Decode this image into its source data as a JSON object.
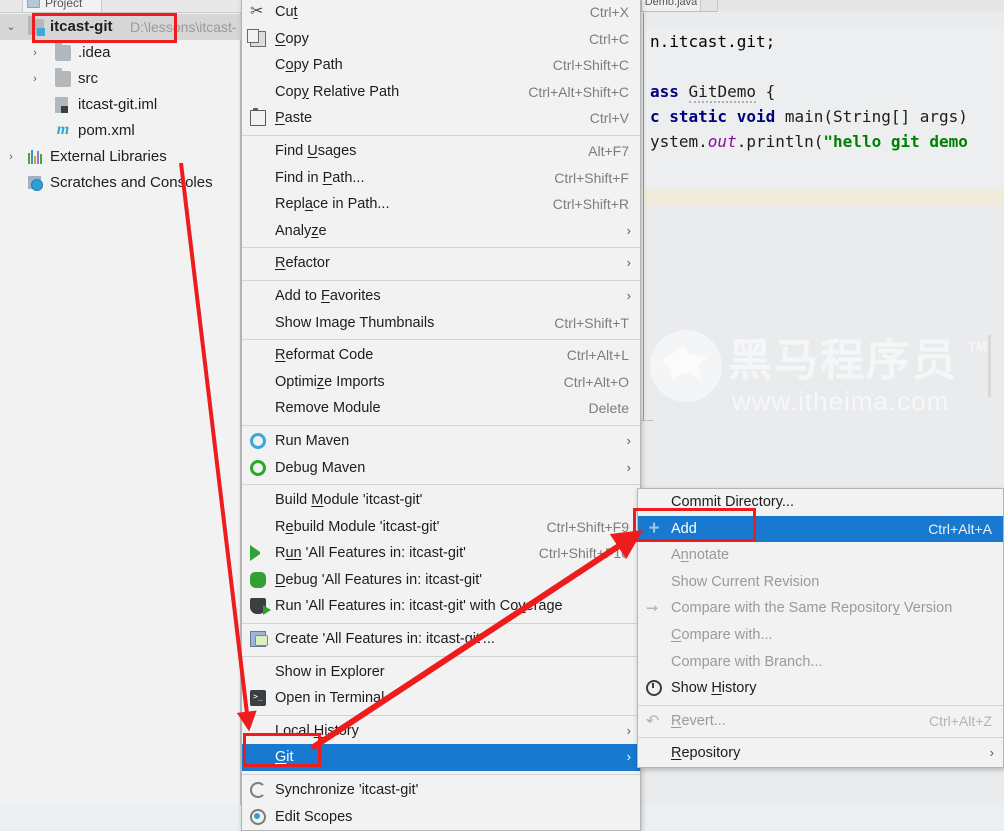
{
  "app": {
    "project_tool_tab": "Project",
    "editor_tab": "Demo.java"
  },
  "project_tree": [
    {
      "label": "itcast-git",
      "path": "D:\\lessons\\itcast-",
      "icon": "module-folder-icon",
      "arrow": "⌄",
      "indent": 0,
      "selected": true,
      "bold": true
    },
    {
      "label": ".idea",
      "path": "",
      "icon": "folder-icon",
      "arrow": "›",
      "indent": 1,
      "selected": false,
      "bold": false
    },
    {
      "label": "src",
      "path": "",
      "icon": "folder-icon",
      "arrow": "›",
      "indent": 1,
      "selected": false,
      "bold": false
    },
    {
      "label": "itcast-git.iml",
      "path": "",
      "icon": "iml-file-icon",
      "arrow": "",
      "indent": 2,
      "selected": false,
      "bold": false
    },
    {
      "label": "pom.xml",
      "path": "",
      "icon": "maven-m-icon",
      "arrow": "",
      "indent": 2,
      "selected": false,
      "bold": false
    },
    {
      "label": "External Libraries",
      "path": "",
      "icon": "libraries-icon",
      "arrow": "›",
      "indent": 0,
      "selected": false,
      "bold": false
    },
    {
      "label": "Scratches and Consoles",
      "path": "",
      "icon": "scratches-icon",
      "arrow": "",
      "indent": 0,
      "selected": false,
      "bold": false
    }
  ],
  "editor": {
    "lines": [
      "n.itcast.git;",
      "",
      "ass GitDemo {",
      "c static void main(String[] args)",
      "ystem.out.println(\"hello git demo"
    ],
    "visible_code_fragment_note": "partially scrolled, left side clipped by menus"
  },
  "watermark": {
    "cn_text": "黑马程序员",
    "tm": "TM",
    "url": "www.itheima.com"
  },
  "context_menu": {
    "name": "project-context-menu",
    "items": [
      {
        "label": "Cut",
        "shortcut": "Ctrl+X",
        "icon": "cut-icon",
        "arrow": false,
        "state": "normal",
        "mnemonic": "t"
      },
      {
        "label": "Copy",
        "shortcut": "Ctrl+C",
        "icon": "copy-icon",
        "arrow": false,
        "state": "normal",
        "mnemonic": "C"
      },
      {
        "label": "Copy Path",
        "shortcut": "Ctrl+Shift+C",
        "icon": "",
        "arrow": false,
        "state": "normal",
        "mnemonic": "o"
      },
      {
        "label": "Copy Relative Path",
        "shortcut": "Ctrl+Alt+Shift+C",
        "icon": "",
        "arrow": false,
        "state": "normal",
        "mnemonic": "y"
      },
      {
        "label": "Paste",
        "shortcut": "Ctrl+V",
        "icon": "paste-icon",
        "arrow": false,
        "state": "normal",
        "mnemonic": "P"
      },
      {
        "separator": true
      },
      {
        "label": "Find Usages",
        "shortcut": "Alt+F7",
        "icon": "",
        "arrow": false,
        "state": "normal",
        "mnemonic": "U"
      },
      {
        "label": "Find in Path...",
        "shortcut": "Ctrl+Shift+F",
        "icon": "",
        "arrow": false,
        "state": "normal",
        "mnemonic": "P"
      },
      {
        "label": "Replace in Path...",
        "shortcut": "Ctrl+Shift+R",
        "icon": "",
        "arrow": false,
        "state": "normal",
        "mnemonic": "a"
      },
      {
        "label": "Analyze",
        "shortcut": "",
        "icon": "",
        "arrow": true,
        "state": "normal",
        "mnemonic": "z"
      },
      {
        "separator": true
      },
      {
        "label": "Refactor",
        "shortcut": "",
        "icon": "",
        "arrow": true,
        "state": "normal",
        "mnemonic": "R"
      },
      {
        "separator": true
      },
      {
        "label": "Add to Favorites",
        "shortcut": "",
        "icon": "",
        "arrow": true,
        "state": "normal",
        "mnemonic": "F"
      },
      {
        "label": "Show Image Thumbnails",
        "shortcut": "Ctrl+Shift+T",
        "icon": "",
        "arrow": false,
        "state": "normal",
        "mnemonic": ""
      },
      {
        "separator": true
      },
      {
        "label": "Reformat Code",
        "shortcut": "Ctrl+Alt+L",
        "icon": "",
        "arrow": false,
        "state": "normal",
        "mnemonic": "R"
      },
      {
        "label": "Optimize Imports",
        "shortcut": "Ctrl+Alt+O",
        "icon": "",
        "arrow": false,
        "state": "normal",
        "mnemonic": "z"
      },
      {
        "label": "Remove Module",
        "shortcut": "Delete",
        "icon": "",
        "arrow": false,
        "state": "normal",
        "mnemonic": ""
      },
      {
        "separator": true
      },
      {
        "label": "Run Maven",
        "shortcut": "",
        "icon": "gear-blue-icon",
        "arrow": true,
        "state": "normal",
        "mnemonic": ""
      },
      {
        "label": "Debug Maven",
        "shortcut": "",
        "icon": "gear-green-icon",
        "arrow": true,
        "state": "normal",
        "mnemonic": ""
      },
      {
        "separator": true
      },
      {
        "label": "Build Module 'itcast-git'",
        "shortcut": "",
        "icon": "",
        "arrow": false,
        "state": "normal",
        "mnemonic": "M"
      },
      {
        "label": "Rebuild Module 'itcast-git'",
        "shortcut": "Ctrl+Shift+F9",
        "icon": "",
        "arrow": false,
        "state": "normal",
        "mnemonic": "e"
      },
      {
        "label": "Run 'All Features in: itcast-git'",
        "shortcut": "Ctrl+Shift+F10",
        "icon": "run-icon",
        "arrow": false,
        "state": "normal",
        "mnemonic": "un"
      },
      {
        "label": "Debug 'All Features in: itcast-git'",
        "shortcut": "",
        "icon": "debug-icon",
        "arrow": false,
        "state": "normal",
        "mnemonic": "D"
      },
      {
        "label": "Run 'All Features in: itcast-git' with Coverage",
        "shortcut": "",
        "icon": "coverage-icon",
        "arrow": false,
        "state": "normal",
        "mnemonic": "v"
      },
      {
        "separator": true
      },
      {
        "label": "Create 'All Features in: itcast-git'...",
        "shortcut": "",
        "icon": "create-config-icon",
        "arrow": false,
        "state": "normal",
        "mnemonic": ""
      },
      {
        "separator": true
      },
      {
        "label": "Show in Explorer",
        "shortcut": "",
        "icon": "",
        "arrow": false,
        "state": "normal",
        "mnemonic": ""
      },
      {
        "label": "Open in Terminal",
        "shortcut": "",
        "icon": "terminal-icon",
        "arrow": false,
        "state": "normal",
        "mnemonic": ""
      },
      {
        "separator": true
      },
      {
        "label": "Local History",
        "shortcut": "",
        "icon": "",
        "arrow": true,
        "state": "normal",
        "mnemonic": "H"
      },
      {
        "label": "Git",
        "shortcut": "",
        "icon": "",
        "arrow": true,
        "state": "selected",
        "mnemonic": "G"
      },
      {
        "separator": true
      },
      {
        "label": "Synchronize 'itcast-git'",
        "shortcut": "",
        "icon": "sync-icon",
        "arrow": false,
        "state": "normal",
        "mnemonic": ""
      },
      {
        "label": "Edit Scopes",
        "shortcut": "",
        "icon": "scopes-icon",
        "arrow": false,
        "state": "normal",
        "mnemonic": ""
      }
    ]
  },
  "git_submenu": {
    "name": "git-submenu",
    "items": [
      {
        "label": "Commit Directory...",
        "shortcut": "",
        "icon": "",
        "arrow": false,
        "state": "normal",
        "mnemonic": ""
      },
      {
        "label": "Add",
        "shortcut": "Ctrl+Alt+A",
        "icon": "add-plus-icon",
        "arrow": false,
        "state": "selected",
        "mnemonic": ""
      },
      {
        "label": "Annotate",
        "shortcut": "",
        "icon": "",
        "arrow": false,
        "state": "disabled",
        "mnemonic": "n"
      },
      {
        "label": "Show Current Revision",
        "shortcut": "",
        "icon": "",
        "arrow": false,
        "state": "disabled",
        "mnemonic": ""
      },
      {
        "label": "Compare with the Same Repository Version",
        "shortcut": "",
        "icon": "compare-icon",
        "arrow": false,
        "state": "disabled",
        "mnemonic": "y"
      },
      {
        "label": "Compare with...",
        "shortcut": "",
        "icon": "",
        "arrow": false,
        "state": "disabled",
        "mnemonic": "C"
      },
      {
        "label": "Compare with Branch...",
        "shortcut": "",
        "icon": "",
        "arrow": false,
        "state": "disabled",
        "mnemonic": ""
      },
      {
        "label": "Show History",
        "shortcut": "",
        "icon": "history-icon",
        "arrow": false,
        "state": "normal",
        "mnemonic": "H"
      },
      {
        "separator": true
      },
      {
        "label": "Revert...",
        "shortcut": "Ctrl+Alt+Z",
        "icon": "revert-icon",
        "arrow": false,
        "state": "disabled",
        "mnemonic": "R"
      },
      {
        "separator": true
      },
      {
        "label": "Repository",
        "shortcut": "",
        "icon": "",
        "arrow": true,
        "state": "normal",
        "mnemonic": "R"
      }
    ]
  },
  "annotations": {
    "highlight_color": "#ee1c1c",
    "selection_color": "#1879d1",
    "boxes": [
      {
        "name": "itcast-git-node-highlight"
      },
      {
        "name": "git-menu-item-highlight"
      },
      {
        "name": "add-menu-item-highlight"
      }
    ],
    "arrows": [
      {
        "name": "arrow-project-to-git",
        "from": "itcast-git project node",
        "to": "Git menu item"
      },
      {
        "name": "arrow-git-to-add",
        "from": "Git menu item",
        "to": "Add menu item"
      }
    ]
  }
}
